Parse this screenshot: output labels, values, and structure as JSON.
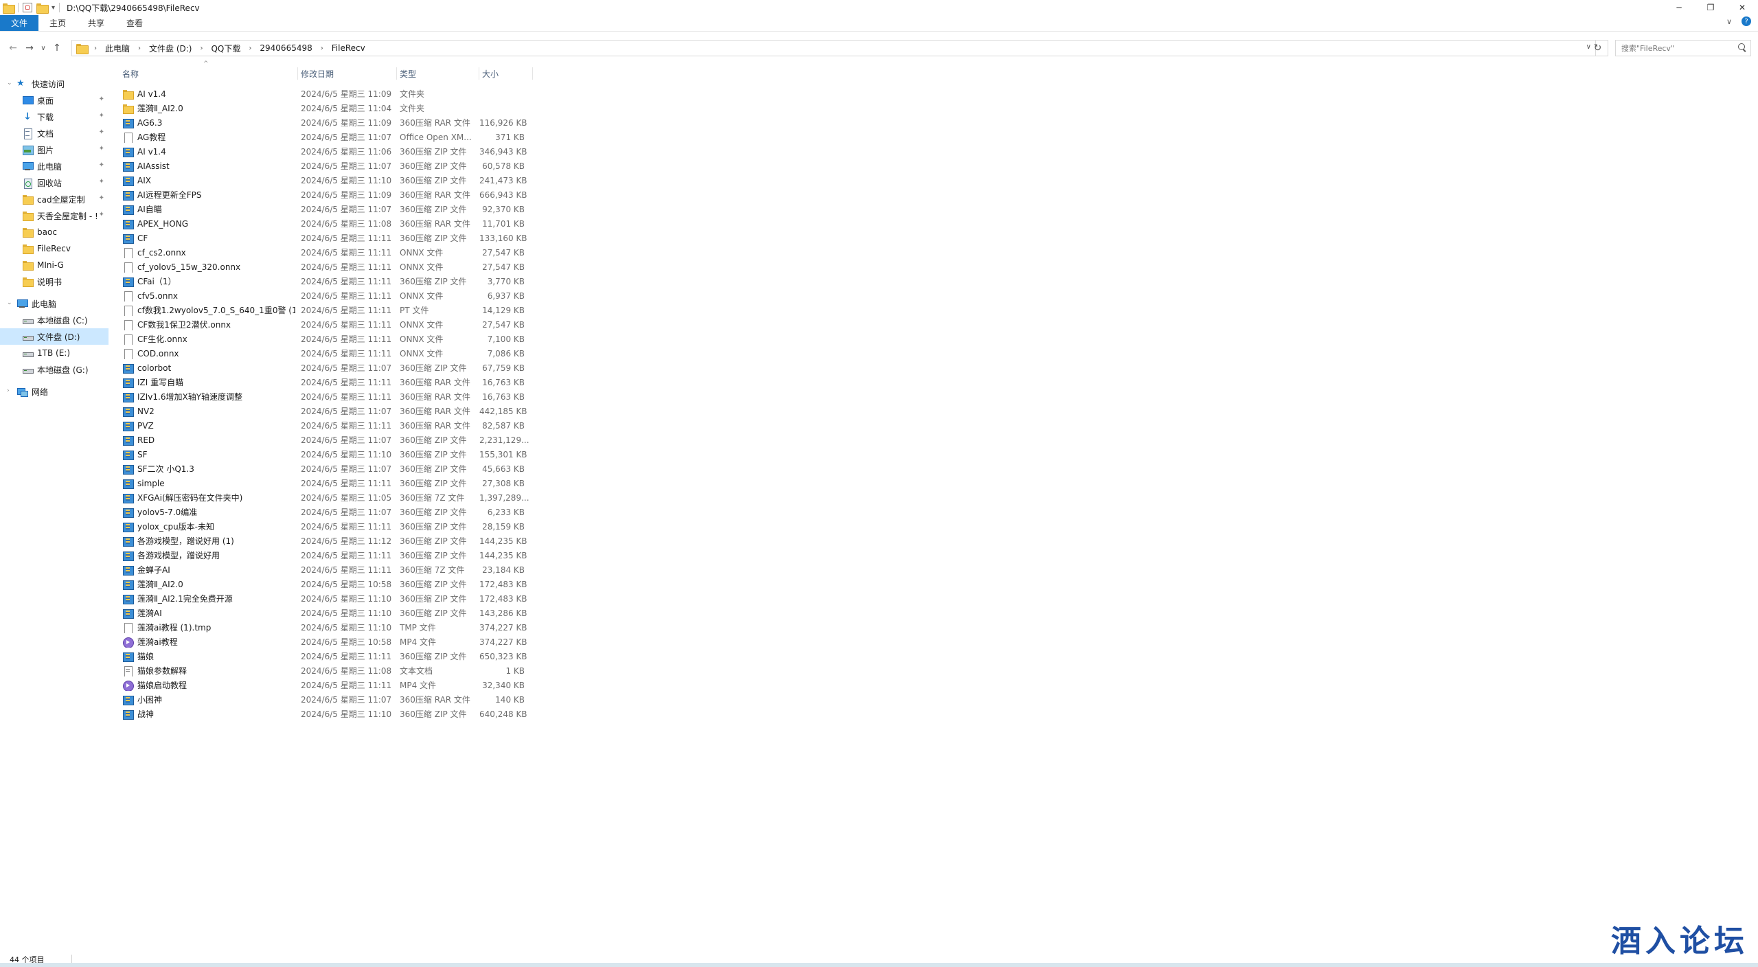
{
  "window": {
    "title": "D:\\QQ下载\\2940665498\\FileRecv",
    "controls": {
      "minimize": "─",
      "restore": "❐",
      "close": "✕"
    }
  },
  "ribbon": {
    "tabs": [
      {
        "label": "文件",
        "active": true
      },
      {
        "label": "主页",
        "active": false
      },
      {
        "label": "共享",
        "active": false
      },
      {
        "label": "查看",
        "active": false
      }
    ],
    "expand_glyph": "∨",
    "help_glyph": "?"
  },
  "nav": {
    "back_glyph": "←",
    "forward_glyph": "→",
    "recent_glyph": "∨",
    "up_glyph": "↑",
    "breadcrumb": [
      "此电脑",
      "文件盘 (D:)",
      "QQ下载",
      "2940665498",
      "FileRecv"
    ],
    "crumb_sep": "›",
    "dropdown_glyph": "∨",
    "refresh_glyph": "↻",
    "search_placeholder": "搜索\"FileRecv\""
  },
  "sidebar": {
    "quick_access": {
      "label": "快速访问",
      "icon": "star-icon"
    },
    "quick_items": [
      {
        "label": "桌面",
        "icon": "desktop-icon",
        "pinned": true
      },
      {
        "label": "下载",
        "icon": "download-icon",
        "pinned": true
      },
      {
        "label": "文档",
        "icon": "documents-icon",
        "pinned": true
      },
      {
        "label": "图片",
        "icon": "pictures-icon",
        "pinned": true
      },
      {
        "label": "此电脑",
        "icon": "pc-icon",
        "pinned": true
      },
      {
        "label": "回收站",
        "icon": "recycle-bin-icon",
        "pinned": true
      },
      {
        "label": "cad全屋定制",
        "icon": "folder-icon",
        "pinned": true
      },
      {
        "label": "天香全屋定制 - !",
        "icon": "folder-icon",
        "pinned": true
      },
      {
        "label": "baoc",
        "icon": "folder-icon",
        "pinned": false
      },
      {
        "label": "FileRecv",
        "icon": "folder-icon",
        "pinned": false
      },
      {
        "label": "MIni-G",
        "icon": "folder-icon",
        "pinned": false
      },
      {
        "label": "说明书",
        "icon": "folder-icon",
        "pinned": false
      }
    ],
    "this_pc": {
      "label": "此电脑",
      "icon": "pc-icon"
    },
    "drives": [
      {
        "label": "本地磁盘 (C:)",
        "selected": false
      },
      {
        "label": "文件盘 (D:)",
        "selected": true
      },
      {
        "label": "1TB (E:)",
        "selected": false
      },
      {
        "label": "本地磁盘 (G:)",
        "selected": false
      }
    ],
    "network": {
      "label": "网络",
      "icon": "network-icon"
    },
    "pin_glyph": "📌"
  },
  "columns": {
    "name": "名称",
    "date": "修改日期",
    "type": "类型",
    "size": "大小",
    "sort_glyph": "^"
  },
  "files": [
    {
      "name": "AI v1.4",
      "date": "2024/6/5 星期三 11:09",
      "type": "文件夹",
      "size": "",
      "icon": "folder"
    },
    {
      "name": "莲漪Ⅱ_AI2.0",
      "date": "2024/6/5 星期三 11:04",
      "type": "文件夹",
      "size": "",
      "icon": "folder"
    },
    {
      "name": "AG6.3",
      "date": "2024/6/5 星期三 11:09",
      "type": "360压缩 RAR 文件",
      "size": "116,926 KB",
      "icon": "zip"
    },
    {
      "name": "AG教程",
      "date": "2024/6/5 星期三 11:07",
      "type": "Office Open XM...",
      "size": "371 KB",
      "icon": "file"
    },
    {
      "name": "AI v1.4",
      "date": "2024/6/5 星期三 11:06",
      "type": "360压缩 ZIP 文件",
      "size": "346,943 KB",
      "icon": "zip"
    },
    {
      "name": "AIAssist",
      "date": "2024/6/5 星期三 11:07",
      "type": "360压缩 ZIP 文件",
      "size": "60,578 KB",
      "icon": "zip"
    },
    {
      "name": "AIX",
      "date": "2024/6/5 星期三 11:10",
      "type": "360压缩 ZIP 文件",
      "size": "241,473 KB",
      "icon": "zip"
    },
    {
      "name": "AI远程更新全FPS",
      "date": "2024/6/5 星期三 11:09",
      "type": "360压缩 RAR 文件",
      "size": "666,943 KB",
      "icon": "zip"
    },
    {
      "name": "AI自瞄",
      "date": "2024/6/5 星期三 11:07",
      "type": "360压缩 ZIP 文件",
      "size": "92,370 KB",
      "icon": "zip"
    },
    {
      "name": "APEX_HONG",
      "date": "2024/6/5 星期三 11:08",
      "type": "360压缩 RAR 文件",
      "size": "11,701 KB",
      "icon": "zip"
    },
    {
      "name": "CF",
      "date": "2024/6/5 星期三 11:11",
      "type": "360压缩 ZIP 文件",
      "size": "133,160 KB",
      "icon": "zip"
    },
    {
      "name": "cf_cs2.onnx",
      "date": "2024/6/5 星期三 11:11",
      "type": "ONNX 文件",
      "size": "27,547 KB",
      "icon": "file"
    },
    {
      "name": "cf_yolov5_15w_320.onnx",
      "date": "2024/6/5 星期三 11:11",
      "type": "ONNX 文件",
      "size": "27,547 KB",
      "icon": "file"
    },
    {
      "name": "CFai（1）",
      "date": "2024/6/5 星期三 11:11",
      "type": "360压缩 ZIP 文件",
      "size": "3,770 KB",
      "icon": "zip"
    },
    {
      "name": "cfv5.onnx",
      "date": "2024/6/5 星期三 11:11",
      "type": "ONNX 文件",
      "size": "6,937 KB",
      "icon": "file"
    },
    {
      "name": "cf数我1.2wyolov5_7.0_S_640_1重0警 (1...",
      "date": "2024/6/5 星期三 11:11",
      "type": "PT 文件",
      "size": "14,129 KB",
      "icon": "file"
    },
    {
      "name": "CF数我1保卫2潜伏.onnx",
      "date": "2024/6/5 星期三 11:11",
      "type": "ONNX 文件",
      "size": "27,547 KB",
      "icon": "file"
    },
    {
      "name": "CF生化.onnx",
      "date": "2024/6/5 星期三 11:11",
      "type": "ONNX 文件",
      "size": "7,100 KB",
      "icon": "file"
    },
    {
      "name": "COD.onnx",
      "date": "2024/6/5 星期三 11:11",
      "type": "ONNX 文件",
      "size": "7,086 KB",
      "icon": "file"
    },
    {
      "name": "colorbot",
      "date": "2024/6/5 星期三 11:07",
      "type": "360压缩 ZIP 文件",
      "size": "67,759 KB",
      "icon": "zip"
    },
    {
      "name": "IZI 重写自瞄",
      "date": "2024/6/5 星期三 11:11",
      "type": "360压缩 RAR 文件",
      "size": "16,763 KB",
      "icon": "zip"
    },
    {
      "name": "IZIv1.6增加X轴Y轴速度调整",
      "date": "2024/6/5 星期三 11:11",
      "type": "360压缩 RAR 文件",
      "size": "16,763 KB",
      "icon": "zip"
    },
    {
      "name": "NV2",
      "date": "2024/6/5 星期三 11:07",
      "type": "360压缩 RAR 文件",
      "size": "442,185 KB",
      "icon": "zip"
    },
    {
      "name": "PVZ",
      "date": "2024/6/5 星期三 11:11",
      "type": "360压缩 RAR 文件",
      "size": "82,587 KB",
      "icon": "zip"
    },
    {
      "name": "RED",
      "date": "2024/6/5 星期三 11:07",
      "type": "360压缩 ZIP 文件",
      "size": "2,231,129...",
      "icon": "zip"
    },
    {
      "name": "SF",
      "date": "2024/6/5 星期三 11:10",
      "type": "360压缩 ZIP 文件",
      "size": "155,301 KB",
      "icon": "zip"
    },
    {
      "name": "SF二次 小Q1.3",
      "date": "2024/6/5 星期三 11:07",
      "type": "360压缩 ZIP 文件",
      "size": "45,663 KB",
      "icon": "zip"
    },
    {
      "name": "simple",
      "date": "2024/6/5 星期三 11:11",
      "type": "360压缩 ZIP 文件",
      "size": "27,308 KB",
      "icon": "zip"
    },
    {
      "name": "XFGAi(解压密码在文件夹中)",
      "date": "2024/6/5 星期三 11:05",
      "type": "360压缩 7Z 文件",
      "size": "1,397,289...",
      "icon": "zip"
    },
    {
      "name": "yolov5-7.0编准",
      "date": "2024/6/5 星期三 11:07",
      "type": "360压缩 ZIP 文件",
      "size": "6,233 KB",
      "icon": "zip"
    },
    {
      "name": "yolox_cpu版本-未知",
      "date": "2024/6/5 星期三 11:11",
      "type": "360压缩 ZIP 文件",
      "size": "28,159 KB",
      "icon": "zip"
    },
    {
      "name": "各游戏模型，蹭说好用 (1)",
      "date": "2024/6/5 星期三 11:12",
      "type": "360压缩 ZIP 文件",
      "size": "144,235 KB",
      "icon": "zip"
    },
    {
      "name": "各游戏模型，蹭说好用",
      "date": "2024/6/5 星期三 11:11",
      "type": "360压缩 ZIP 文件",
      "size": "144,235 KB",
      "icon": "zip"
    },
    {
      "name": "金蝉子AI",
      "date": "2024/6/5 星期三 11:11",
      "type": "360压缩 7Z 文件",
      "size": "23,184 KB",
      "icon": "zip"
    },
    {
      "name": "莲漪Ⅱ_AI2.0",
      "date": "2024/6/5 星期三 10:58",
      "type": "360压缩 ZIP 文件",
      "size": "172,483 KB",
      "icon": "zip"
    },
    {
      "name": "莲漪Ⅱ_AI2.1完全免费开源",
      "date": "2024/6/5 星期三 11:10",
      "type": "360压缩 ZIP 文件",
      "size": "172,483 KB",
      "icon": "zip"
    },
    {
      "name": "莲漪AI",
      "date": "2024/6/5 星期三 11:10",
      "type": "360压缩 ZIP 文件",
      "size": "143,286 KB",
      "icon": "zip"
    },
    {
      "name": "莲漪ai教程 (1).tmp",
      "date": "2024/6/5 星期三 11:10",
      "type": "TMP 文件",
      "size": "374,227 KB",
      "icon": "file"
    },
    {
      "name": "莲漪ai教程",
      "date": "2024/6/5 星期三 10:58",
      "type": "MP4 文件",
      "size": "374,227 KB",
      "icon": "mp4"
    },
    {
      "name": "猫娘",
      "date": "2024/6/5 星期三 11:11",
      "type": "360压缩 ZIP 文件",
      "size": "650,323 KB",
      "icon": "zip"
    },
    {
      "name": "猫娘参数解释",
      "date": "2024/6/5 星期三 11:08",
      "type": "文本文档",
      "size": "1 KB",
      "icon": "doc"
    },
    {
      "name": "猫娘启动教程",
      "date": "2024/6/5 星期三 11:11",
      "type": "MP4 文件",
      "size": "32,340 KB",
      "icon": "mp4"
    },
    {
      "name": "小困神",
      "date": "2024/6/5 星期三 11:07",
      "type": "360压缩 RAR 文件",
      "size": "140 KB",
      "icon": "zip"
    },
    {
      "name": "战神",
      "date": "2024/6/5 星期三 11:10",
      "type": "360压缩 ZIP 文件",
      "size": "640,248 KB",
      "icon": "zip"
    }
  ],
  "status": {
    "count": "44 个项目"
  },
  "watermark": "酒入论坛"
}
